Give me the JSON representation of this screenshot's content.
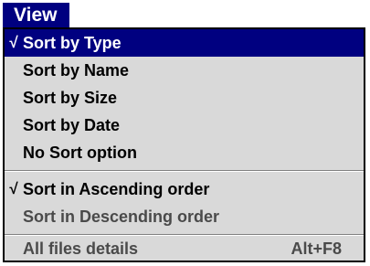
{
  "menu": {
    "title": "View",
    "items": [
      {
        "check": "√",
        "label": "Sort by Type",
        "shortcut": ""
      },
      {
        "check": "",
        "label": "Sort by  Name",
        "shortcut": ""
      },
      {
        "check": "",
        "label": "Sort by Size",
        "shortcut": ""
      },
      {
        "check": "",
        "label": "Sort by Date",
        "shortcut": ""
      },
      {
        "check": "",
        "label": "No Sort option",
        "shortcut": ""
      },
      {
        "check": "√",
        "label": "Sort in Ascending  order",
        "shortcut": ""
      },
      {
        "check": "",
        "label": "Sort in Descending order",
        "shortcut": ""
      },
      {
        "check": "",
        "label": "All files details",
        "shortcut": "Alt+F8"
      }
    ]
  },
  "colors": {
    "highlight": "#000080",
    "menu_bg": "#d9d9d9",
    "disabled_text": "#4a4a4a"
  }
}
